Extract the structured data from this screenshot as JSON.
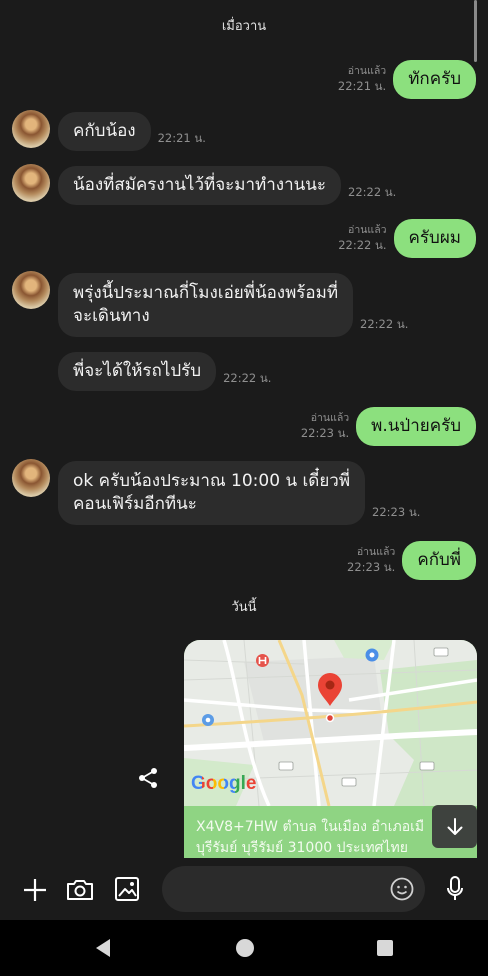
{
  "colors": {
    "background": "#1b1b1b",
    "incoming_bubble": "#2c2c2c",
    "outgoing_bubble": "#8ce07e",
    "timestamp": "#8f8f8f",
    "location_footer": "#8fd483",
    "input_field": "#2b2b2b",
    "nav_bar": "#000000"
  },
  "date_separators": {
    "yesterday": "เมื่อวาน",
    "today": "วันนี้"
  },
  "messages": [
    {
      "outgoing": true,
      "text": "ทักครับ",
      "status": "อ่านแล้ว",
      "time": "22:21 น."
    },
    {
      "outgoing": false,
      "show_avatar": true,
      "text": "คกับน้อง",
      "time": "22:21 น."
    },
    {
      "outgoing": false,
      "show_avatar": true,
      "text": "น้องที่สมัครงานไว้ที่จะมาทำงานนะ",
      "time": "22:22 น."
    },
    {
      "outgoing": true,
      "text": "ครับผม",
      "status": "อ่านแล้ว",
      "time": "22:22 น."
    },
    {
      "outgoing": false,
      "show_avatar": true,
      "text": "พรุ่งนี้ประมาณกี่โมงเอ่ยพี่น้องพร้อมที่\nจะเดินทาง",
      "time": "22:22 น."
    },
    {
      "outgoing": false,
      "show_avatar": false,
      "text": "พี่จะได้ให้รถไปรับ",
      "time": "22:22 น."
    },
    {
      "outgoing": true,
      "text": "พ.นป่ายครับ",
      "status": "อ่านแล้ว",
      "time": "22:23 น."
    },
    {
      "outgoing": false,
      "show_avatar": true,
      "text": "ok ครับน้องประมาณ 10:00 น เดี๋ยวพี่\nคอนเฟิร์มอีกทีนะ",
      "time": "22:23 น."
    },
    {
      "outgoing": true,
      "text": "คกับพี่",
      "status": "อ่านแล้ว",
      "time": "22:23 น."
    }
  ],
  "location_message": {
    "map_logo": "Google",
    "address_line1": "X4V8+7HW ตำบล ในเมือง อำเภอเมื",
    "address_line2": "บุรีรัมย์ บุรีรัมย์ 31000 ประเทศไทย"
  },
  "message_field": {
    "value": "",
    "placeholder": ""
  },
  "icons": {
    "share": "share-icon",
    "scroll_down": "arrow-down-icon",
    "add": "plus-icon",
    "camera": "camera-icon",
    "gallery": "image-icon",
    "emoji": "emoji-icon",
    "voice": "microphone-icon",
    "nav_back": "back-icon",
    "nav_home": "home-icon",
    "nav_recents": "recents-icon"
  }
}
